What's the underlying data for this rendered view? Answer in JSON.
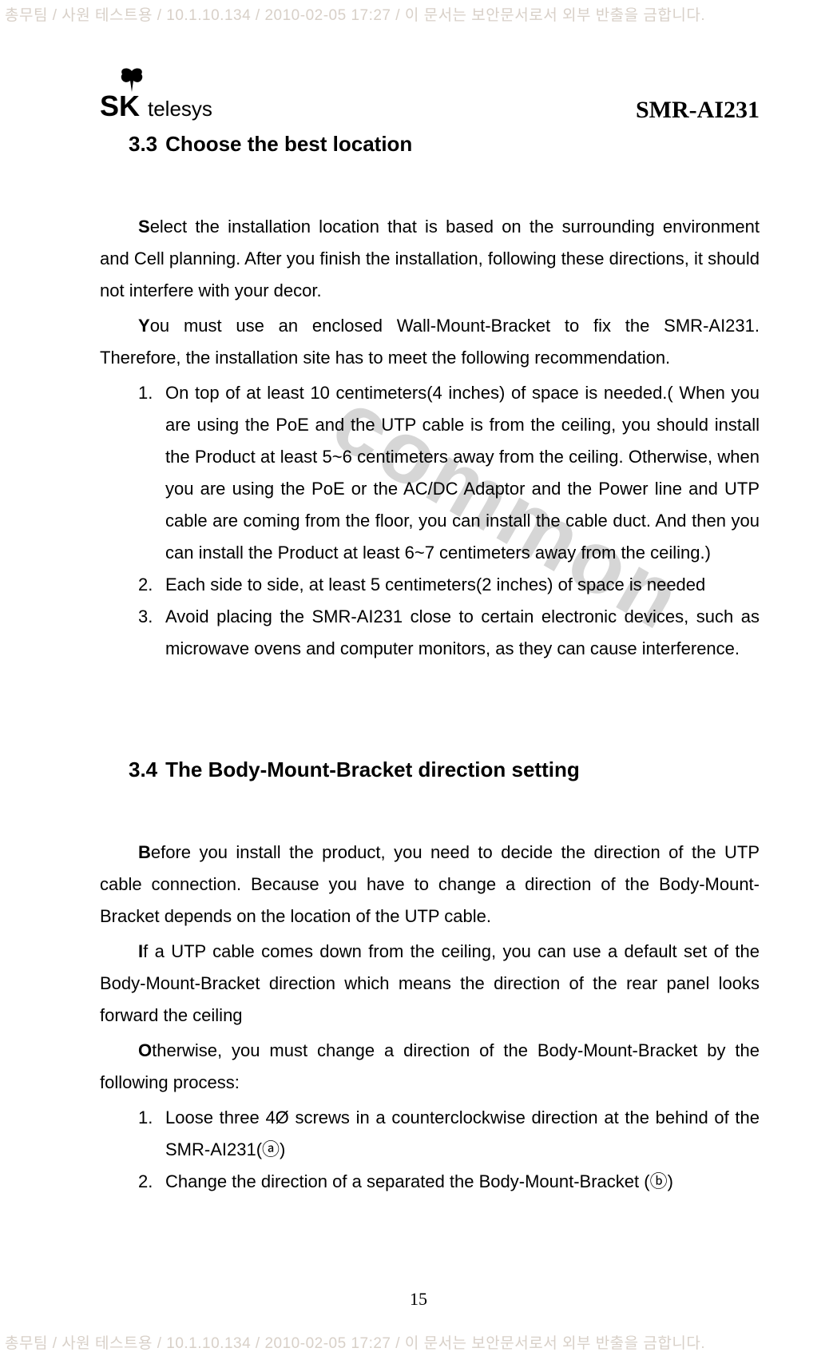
{
  "header_text": "총무팀 / 사원 테스트용 / 10.1.10.134 / 2010-02-05 17:27 /  이 문서는 보안문서로서 외부 반출을 금합니다.",
  "footer_text": "총무팀 / 사원 테스트용 / 10.1.10.134 / 2010-02-05 17:27 /  이 문서는 보안문서로서 외부 반출을 금합니다.",
  "logo_text_sk": "SK",
  "logo_text_telesys": "telesys",
  "product_id": "SMR-AI231",
  "watermark": "common",
  "page_number": "15",
  "section_33": {
    "num": "3.3",
    "title": "Choose the best location",
    "para1_first": "S",
    "para1_rest": "elect the installation location that is based on the surrounding environment and Cell planning. After you finish the installation, following these directions, it should not interfere with your decor.",
    "para2_first": "Y",
    "para2_rest": "ou must use an enclosed Wall-Mount-Bracket to fix the SMR-AI231. Therefore, the installation site has to meet the following recommendation.",
    "items": [
      {
        "num": "1.",
        "text": "On top of at least 10 centimeters(4 inches) of space is needed.( When you are using the PoE and the UTP cable is from the ceiling, you should install the Product at least 5~6 centimeters away from the ceiling. Otherwise, when you are using the PoE or the AC/DC Adaptor and the Power line and UTP cable are coming from the floor, you can install the cable duct. And then you can install the Product at least 6~7 centimeters away from the ceiling.)"
      },
      {
        "num": "2.",
        "text": "Each side to side, at least 5 centimeters(2 inches) of space is needed"
      },
      {
        "num": "3.",
        "text": "Avoid placing the SMR-AI231 close to certain electronic devices, such as microwave ovens and computer monitors, as they can cause interference."
      }
    ]
  },
  "section_34": {
    "num": "3.4",
    "title": "The Body-Mount-Bracket direction setting",
    "para1_first": "B",
    "para1_rest": "efore you install the product, you need to decide the direction of the UTP cable connection. Because you have to change a direction of the Body-Mount-Bracket depends on the location of the UTP cable.",
    "para2_first": "I",
    "para2_rest": "f a UTP cable comes down from the ceiling, you can use a default set of the Body-Mount-Bracket direction which means the direction of the rear panel looks forward the ceiling",
    "para3_first": "O",
    "para3_rest": "therwise, you must change a direction of the Body-Mount-Bracket by the following process:",
    "items": [
      {
        "num": "1.",
        "text": "Loose three 4Ø screws in a counterclockwise direction at the behind of the SMR-AI231(ⓐ)"
      },
      {
        "num": "2.",
        "text": "Change the direction of a separated the Body-Mount-Bracket (ⓑ)"
      }
    ]
  }
}
